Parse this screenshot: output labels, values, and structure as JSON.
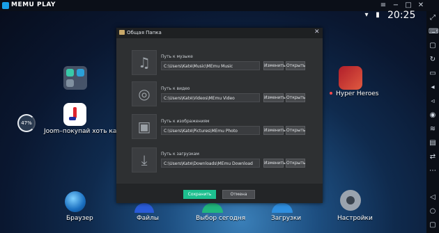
{
  "app": {
    "title": "MEMU PLAY"
  },
  "window_controls": {
    "menu": "≡",
    "minimize": "−",
    "maximize": "□",
    "close": "✕"
  },
  "statusbar": {
    "time": "20:25",
    "progress": "47%"
  },
  "home": {
    "left_app_label": "Joom–покупай хоть кажд...",
    "right_app_label": "Hyper Heroes",
    "dock": [
      "Браузер",
      "Файлы",
      "Выбор сегодня",
      "Загрузки",
      "Настройки"
    ]
  },
  "dialog": {
    "title": "Общая Папка",
    "rows": [
      {
        "label": "Путь к музыке",
        "path": "C:\\Users\\Katя\\Music\\MEmu Music",
        "icon": "music-note-icon",
        "glyph": "♫"
      },
      {
        "label": "Путь к видео",
        "path": "C:\\Users\\Katя\\Videos\\MEmu Video",
        "icon": "film-reel-icon",
        "glyph": "◎"
      },
      {
        "label": "Путь к изображениям",
        "path": "C:\\Users\\Katя\\Pictures\\MEmu Photo",
        "icon": "image-icon",
        "glyph": "▣"
      },
      {
        "label": "Путь к загрузкам",
        "path": "C:\\Users\\Katя\\Downloads\\MEmu Download",
        "icon": "download-folder-icon",
        "glyph": "⤓"
      }
    ],
    "change_label": "Изменить",
    "open_label": "Открыть",
    "save_label": "Сохранить",
    "cancel_label": "Отмена"
  },
  "colors": {
    "accent": "#1dbf8f",
    "dialog_bg": "#2e3032"
  }
}
